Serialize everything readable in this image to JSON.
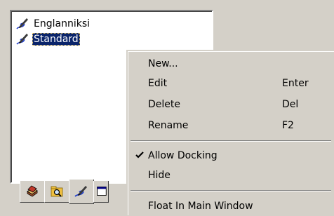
{
  "list": {
    "items": [
      {
        "label": "Englanniksi",
        "icon": "pen-icon",
        "selected": false
      },
      {
        "label": "Standard",
        "icon": "pen-icon",
        "selected": true
      }
    ]
  },
  "tabs": [
    {
      "icon": "book-stack-icon"
    },
    {
      "icon": "search-folder-icon"
    },
    {
      "icon": "pen-icon",
      "active": true
    },
    {
      "icon": "window-icon"
    }
  ],
  "menu": {
    "items": [
      {
        "label": "New...",
        "accel": ""
      },
      {
        "label": "Edit",
        "accel": "Enter"
      },
      {
        "label": "Delete",
        "accel": "Del"
      },
      {
        "label": "Rename",
        "accel": "F2"
      },
      {
        "label": "Allow Docking",
        "accel": "",
        "checked": true
      },
      {
        "label": "Hide",
        "accel": ""
      },
      {
        "label": "Float In Main Window",
        "accel": ""
      }
    ]
  },
  "colors": {
    "selection": "#0a246a",
    "face": "#d4d0c8",
    "pen": "#1e3cc8"
  }
}
